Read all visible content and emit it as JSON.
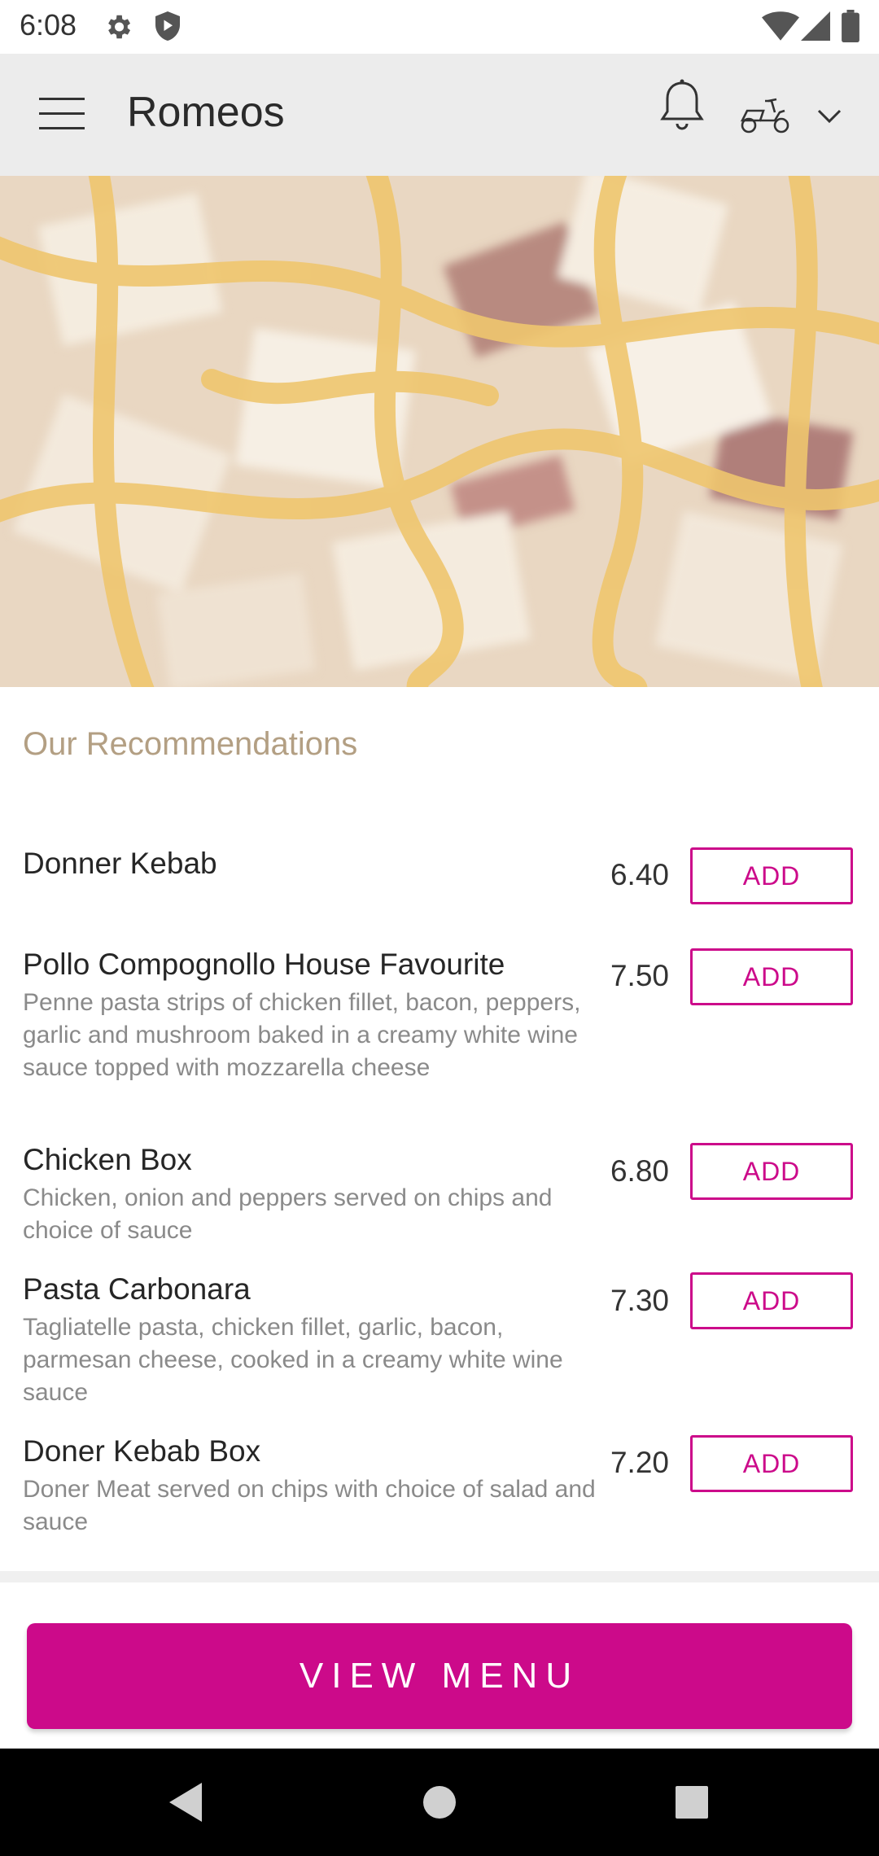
{
  "status_bar": {
    "time": "6:08",
    "icons": [
      "gear-icon",
      "shield-icon",
      "wifi-icon",
      "signal-icon",
      "battery-icon"
    ]
  },
  "app_bar": {
    "title": "Romeos",
    "icons": [
      "hamburger-menu-icon",
      "bell-icon",
      "scooter-delivery-icon",
      "chevron-down-icon"
    ]
  },
  "hero": {
    "image": "pizza-closeup-photo"
  },
  "recommendations": {
    "title": "Our Recommendations",
    "add_label": "ADD",
    "items": [
      {
        "name": "Donner Kebab",
        "desc": "",
        "price": "6.40"
      },
      {
        "name": "Pollo Compognollo House Favourite",
        "desc": "Penne pasta strips of chicken fillet, bacon, peppers, garlic and mushroom baked in a creamy white wine sauce topped with mozzarella cheese",
        "price": "7.50"
      },
      {
        "name": "Chicken Box",
        "desc": "Chicken, onion and peppers served on chips and choice of sauce",
        "price": "6.80"
      },
      {
        "name": "Pasta Carbonara",
        "desc": "Tagliatelle pasta, chicken fillet, garlic, bacon, parmesan cheese, cooked in a creamy white wine sauce",
        "price": "7.30"
      },
      {
        "name": "Doner Kebab Box",
        "desc": "Doner Meat served on chips with choice of salad and sauce",
        "price": "7.20"
      }
    ]
  },
  "view_menu_label": "VIEW MENU",
  "colors": {
    "accent": "#cc0a8a",
    "section_title": "#b39f83",
    "app_bar_bg": "#ececec"
  },
  "nav_bar": {
    "icons": [
      "back-icon",
      "home-icon",
      "recents-icon"
    ]
  }
}
